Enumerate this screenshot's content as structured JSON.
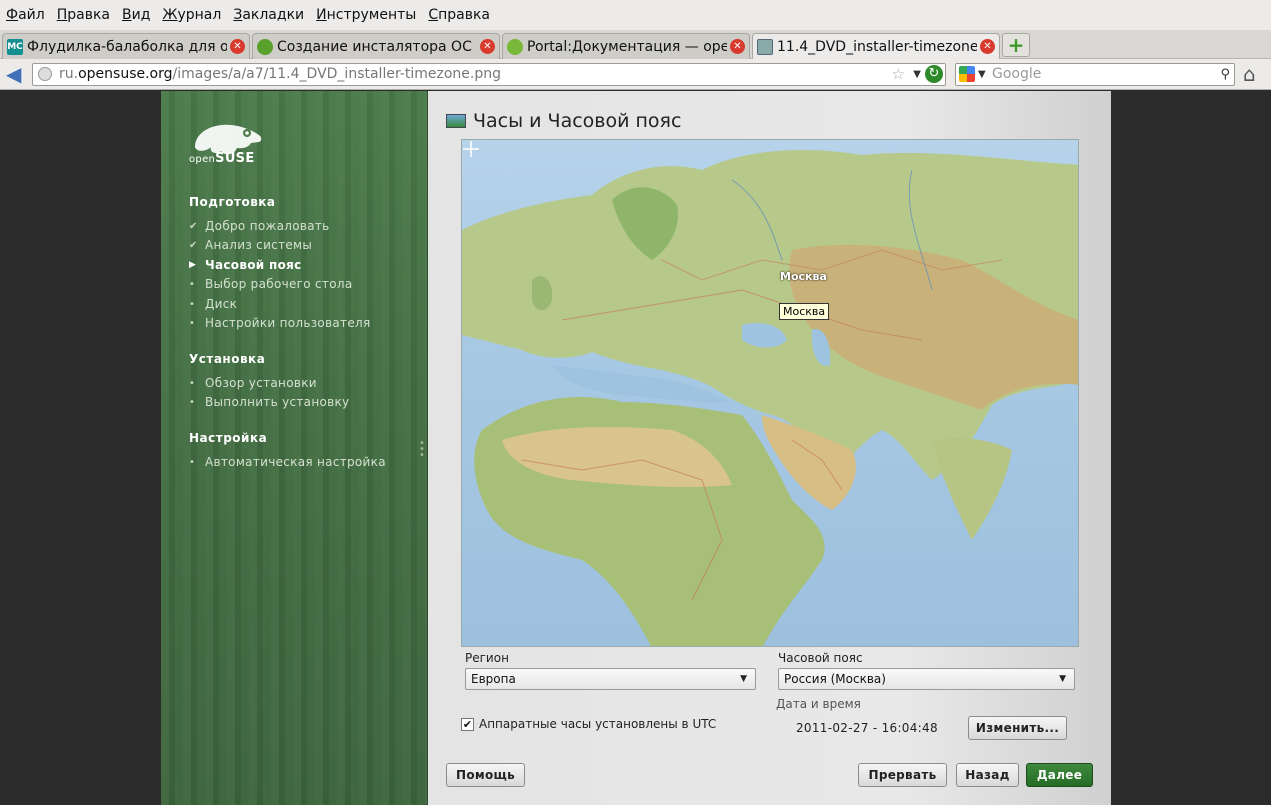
{
  "browser": {
    "menu": [
      "Файл",
      "Правка",
      "Вид",
      "Журнал",
      "Закладки",
      "Инструменты",
      "Справка"
    ],
    "tabs": [
      {
        "label": "Флудилка-балаболка для о…",
        "favicon": "MC"
      },
      {
        "label": "Создание инсталятора ОС …",
        "favicon": ""
      },
      {
        "label": "Portal:Документация — ope…",
        "favicon": ""
      },
      {
        "label": "11.4_DVD_installer-timezone…",
        "favicon": ""
      }
    ],
    "url": {
      "prefix": "ru.",
      "host": "opensuse.org",
      "path": "/images/a/a7/11.4_DVD_installer-timezone.png"
    },
    "search_placeholder": "Google"
  },
  "installer": {
    "logo": {
      "prefix": "open",
      "brand": "SUSE"
    },
    "sections": [
      {
        "title": "Подготовка",
        "steps": [
          {
            "label": "Добро пожаловать",
            "state": "done"
          },
          {
            "label": "Анализ системы",
            "state": "done"
          },
          {
            "label": "Часовой пояс",
            "state": "current"
          },
          {
            "label": "Выбор рабочего стола",
            "state": "todo"
          },
          {
            "label": "Диск",
            "state": "todo"
          },
          {
            "label": "Настройки пользователя",
            "state": "todo"
          }
        ]
      },
      {
        "title": "Установка",
        "steps": [
          {
            "label": "Обзор установки",
            "state": "todo"
          },
          {
            "label": "Выполнить установку",
            "state": "todo"
          }
        ]
      },
      {
        "title": "Настройка",
        "steps": [
          {
            "label": "Автоматическая настройка",
            "state": "todo"
          }
        ]
      }
    ],
    "module_title": "Часы и Часовой пояс",
    "map": {
      "city_label": "Москва",
      "tooltip": "Москва"
    },
    "region": {
      "label": "Регион",
      "value": "Европа"
    },
    "timezone": {
      "label": "Часовой пояс",
      "value": "Россия (Москва)"
    },
    "hw_clock": {
      "label": "Аппаратные часы установлены в UTC",
      "checked": true
    },
    "datetime": {
      "label": "Дата и время",
      "value": "2011-02-27 - 16:04:48"
    },
    "buttons": {
      "change": "Изменить...",
      "help": "Помощь",
      "abort": "Прервать",
      "back": "Назад",
      "next": "Далее"
    },
    "colors": {
      "sidebar": "#436e43",
      "primary_button": "#2f7a2f"
    }
  }
}
